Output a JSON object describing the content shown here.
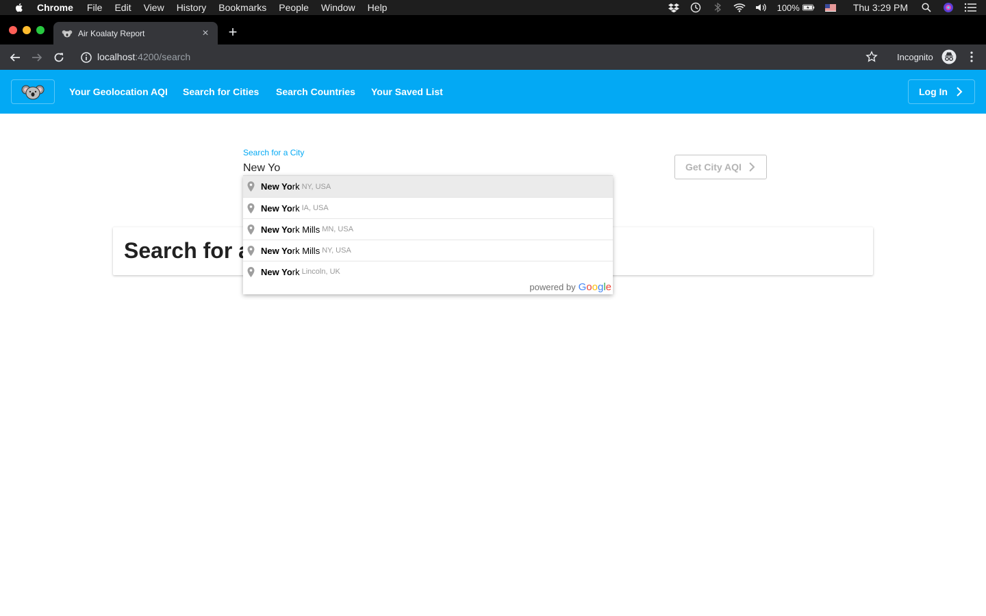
{
  "menubar": {
    "app_name": "Chrome",
    "items": [
      "File",
      "Edit",
      "View",
      "History",
      "Bookmarks",
      "People",
      "Window",
      "Help"
    ],
    "battery": "100%",
    "clock": "Thu 3:29 PM"
  },
  "browser": {
    "tab_title": "Air Koalaty Report",
    "url_host": "localhost",
    "url_path": ":4200/search",
    "incognito_label": "Incognito"
  },
  "nav": {
    "links": [
      "Your Geolocation AQI",
      "Search for Cities",
      "Search Countries",
      "Your Saved List"
    ],
    "login_label": "Log In",
    "accent_color": "#03a9f4"
  },
  "search": {
    "label": "Search for a City",
    "value": "New Yo",
    "button_label": "Get City AQI"
  },
  "card": {
    "title": "Search for a"
  },
  "autocomplete": {
    "items": [
      {
        "match": "New Yo",
        "rest": "rk",
        "secondary": "NY, USA"
      },
      {
        "match": "New Yo",
        "rest": "rk",
        "secondary": "IA, USA"
      },
      {
        "match": "New Yo",
        "rest": "rk Mills",
        "secondary": "MN, USA"
      },
      {
        "match": "New Yo",
        "rest": "rk Mills",
        "secondary": "NY, USA"
      },
      {
        "match": "New Yo",
        "rest": "rk",
        "secondary": "Lincoln, UK"
      }
    ],
    "powered_by": "powered by",
    "brand": "Google"
  }
}
